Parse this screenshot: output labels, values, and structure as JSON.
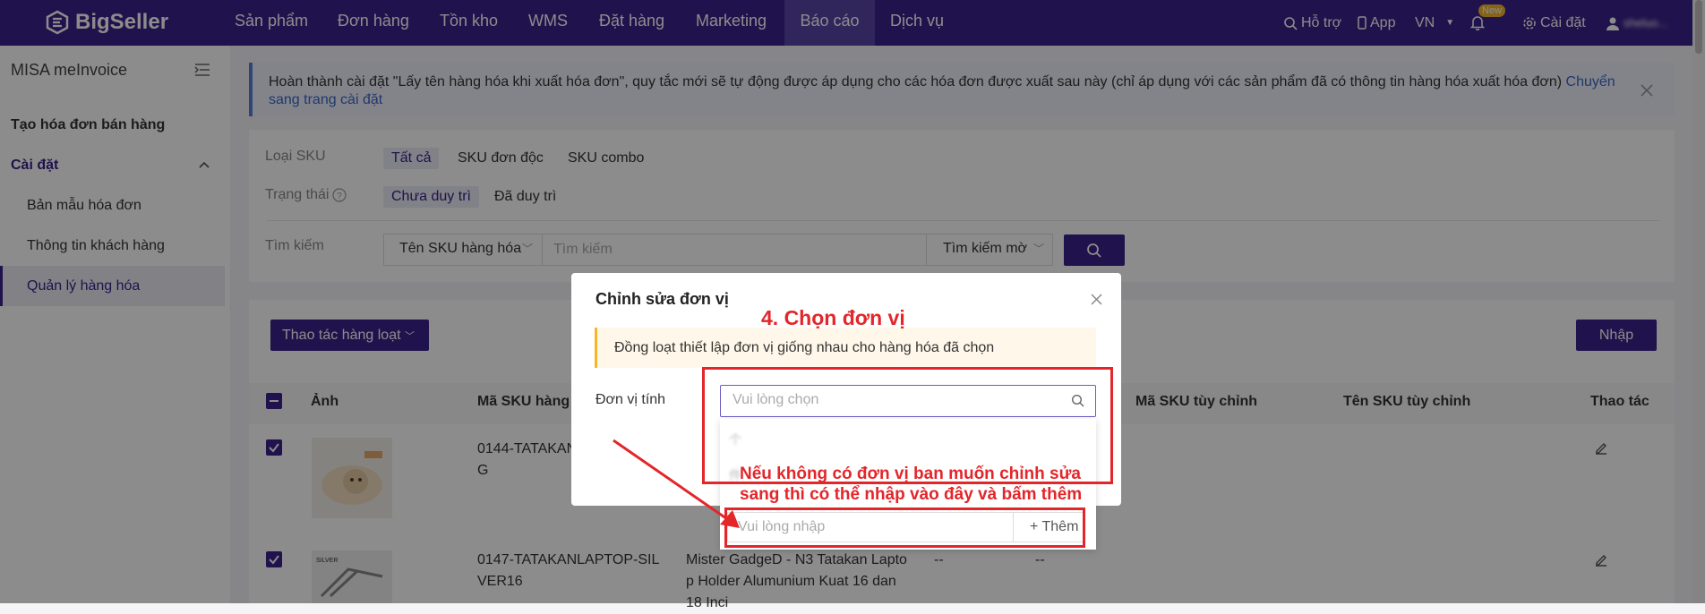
{
  "topnav": {
    "brand": "BigSeller",
    "items": [
      "Sản phẩm",
      "Đơn hàng",
      "Tồn kho",
      "WMS",
      "Đặt hàng",
      "Marketing",
      "Báo cáo",
      "Dịch vụ"
    ],
    "active_item": "Báo cáo",
    "support": "Hỗ trợ",
    "app": "App",
    "lang": "VN",
    "new_badge": "New",
    "settings": "Cài đặt",
    "username": "sheluo..."
  },
  "sidebar": {
    "title": "MISA meInvoice",
    "create_invoice": "Tạo hóa đơn bán hàng",
    "settings_group": "Cài đặt",
    "sub_items": [
      "Bản mẫu hóa đơn",
      "Thông tin khách hàng",
      "Quản lý hàng hóa"
    ],
    "active": "Quản lý hàng hóa"
  },
  "banner": {
    "text": "Hoàn thành cài đặt \"Lấy tên hàng hóa khi xuất hóa đơn\", quy tắc mới sẽ tự động được áp dụng cho các hóa đơn được xuất sau này (chỉ áp dụng với các sản phẩm đã có thông tin hàng hóa xuất hóa đơn)",
    "link": "Chuyển sang trang cài đặt"
  },
  "filters": {
    "sku_type_label": "Loại SKU",
    "sku_type_options": [
      "Tất cả",
      "SKU đơn độc",
      "SKU combo"
    ],
    "status_label": "Trạng thái",
    "status_options": [
      "Chưa duy trì",
      "Đã duy trì"
    ],
    "search_label": "Tìm kiếm",
    "search_field": "Tên SKU hàng hóa",
    "search_placeholder": "Tìm kiếm",
    "search_mode": "Tìm kiếm mờ"
  },
  "toolbar": {
    "bulk": "Thao tác hàng loạt",
    "import": "Nhập"
  },
  "table": {
    "headers": [
      "Ảnh",
      "Mã SKU hàng h",
      "Mã SKU tùy chỉnh",
      "Tên SKU tùy chỉnh",
      "Thao tác"
    ],
    "rows": [
      {
        "sku_line1": "0144-TATAKAN",
        "sku_line2": "G"
      },
      {
        "sku_line1": "0147-TATAKANLAPTOP-SIL",
        "sku_line2": "VER16",
        "name_line1": "Mister GadgeD - N3 Tatakan Lapto",
        "name_line2": "p Holder Alumunium Kuat 16 dan",
        "name_line3": "18 Inci",
        "dash1": "--",
        "dash2": "--"
      }
    ]
  },
  "modal": {
    "title": "Chỉnh sửa đơn vị",
    "alert": "Đồng loạt thiết lập đơn vị giống nhau cho hàng hóa đã chọn",
    "field_label": "Đơn vị tính",
    "select_placeholder": "Vui lòng chọn",
    "options": [
      "个",
      "件"
    ],
    "add_placeholder": "Vui lòng nhập",
    "add_button": "Thêm"
  },
  "annotations": {
    "step": "4. Chọn đơn vị",
    "hint_line1": "Nếu không có đơn vị ban muốn chỉnh sửa",
    "hint_line2": "sang thì có thể nhập vào đây và bấm thêm",
    "color": "#e3262a"
  }
}
